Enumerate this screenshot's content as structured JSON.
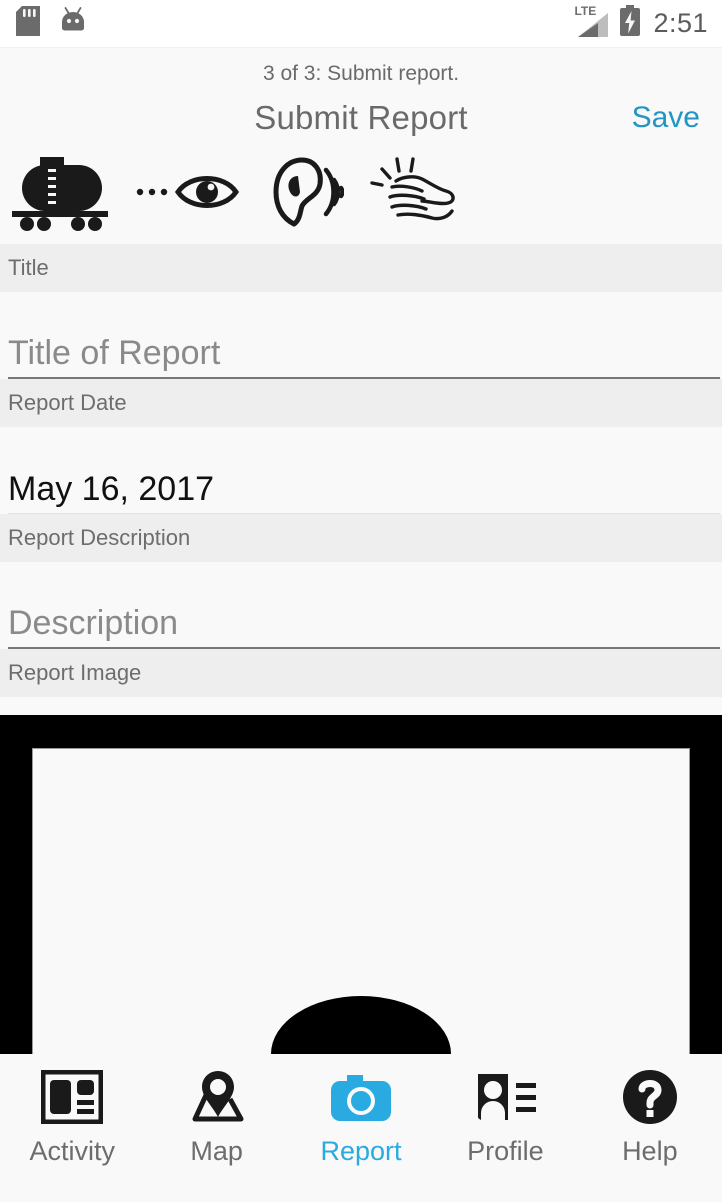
{
  "status_bar": {
    "icons": [
      "sd-card-icon",
      "android-robot-icon"
    ],
    "network_label": "LTE",
    "signal_icon": "signal-bars-icon",
    "battery_icon": "battery-charging-icon",
    "clock": "2:51"
  },
  "header": {
    "step_indicator": "3 of 3: Submit report.",
    "title": "Submit Report",
    "save_label": "Save"
  },
  "sense_row": {
    "icons": [
      {
        "name": "tank-car-icon",
        "label": "Tank Car"
      },
      {
        "name": "eye-see-icon",
        "label": "See"
      },
      {
        "name": "ear-hear-icon",
        "label": "Hear"
      },
      {
        "name": "hands-feel-icon",
        "label": "Feel"
      }
    ]
  },
  "form": {
    "fields": [
      {
        "section": "Title",
        "placeholder": "Title of Report",
        "value": "",
        "state": "placeholder"
      },
      {
        "section": "Report Date",
        "placeholder": "Report Date",
        "value": "May 16, 2017",
        "state": "value"
      },
      {
        "section": "Report Description",
        "placeholder": "Description",
        "value": "",
        "state": "placeholder"
      },
      {
        "section": "Report Image",
        "placeholder": "",
        "value": "",
        "state": "image"
      }
    ]
  },
  "image_picker": {
    "name": "report-image-preview"
  },
  "bottom_nav": {
    "active_color": "#29abe2",
    "inactive_color": "#6d6d6d",
    "items": [
      {
        "label": "Activity",
        "icon": "activity-article-icon",
        "active": false
      },
      {
        "label": "Map",
        "icon": "map-pin-icon",
        "active": false
      },
      {
        "label": "Report",
        "icon": "camera-icon",
        "active": true
      },
      {
        "label": "Profile",
        "icon": "id-card-icon",
        "active": false
      },
      {
        "label": "Help",
        "icon": "question-mark-circle-icon",
        "active": false
      }
    ]
  }
}
